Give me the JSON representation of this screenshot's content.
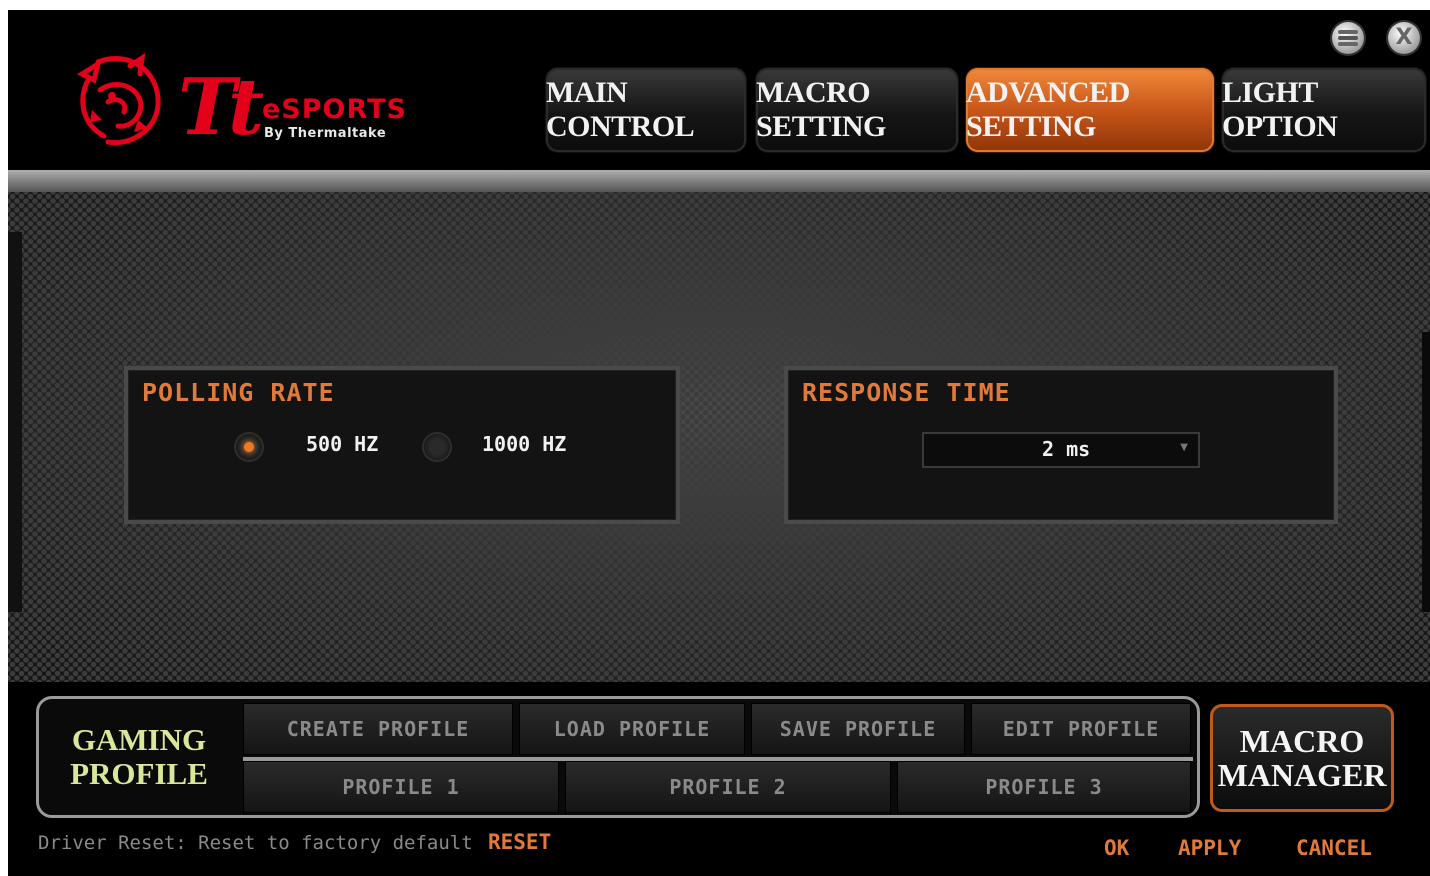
{
  "header": {
    "logo_tt": "Tt",
    "logo_esports": "eSPORTS",
    "logo_by": "By Thermaltake",
    "tabs": [
      {
        "label": "MAIN CONTROL",
        "active": false
      },
      {
        "label": "MACRO SETTING",
        "active": false
      },
      {
        "label": "ADVANCED SETTING",
        "active": true
      },
      {
        "label": "LIGHT OPTION",
        "active": false
      }
    ],
    "window_close_glyph": "X"
  },
  "polling_rate": {
    "title": "POLLING RATE",
    "options": [
      {
        "label": "500 HZ",
        "selected": true
      },
      {
        "label": "1000 HZ",
        "selected": false
      }
    ]
  },
  "response_time": {
    "title": "RESPONSE TIME",
    "value": "2 ms"
  },
  "footer": {
    "gaming_profile_line1": "GAMING",
    "gaming_profile_line2": "PROFILE",
    "actions": [
      "CREATE PROFILE",
      "LOAD PROFILE",
      "SAVE PROFILE",
      "EDIT PROFILE"
    ],
    "profiles": [
      "PROFILE 1",
      "PROFILE 2",
      "PROFILE 3"
    ],
    "macro_manager_line1": "MACRO",
    "macro_manager_line2": "MANAGER",
    "driver_reset_text": "Driver Reset: Reset to factory default",
    "reset_label": "RESET",
    "ok_label": "OK",
    "apply_label": "APPLY",
    "cancel_label": "CANCEL"
  },
  "colors": {
    "accent": "#e07a3a",
    "brand_red": "#e3001b",
    "gaming_profile_text": "#d8e89a"
  },
  "icons": {
    "logo": "tiger-logo-icon",
    "minimize": "minimize-icon",
    "close": "close-icon",
    "dropdown": "chevron-down-icon"
  }
}
